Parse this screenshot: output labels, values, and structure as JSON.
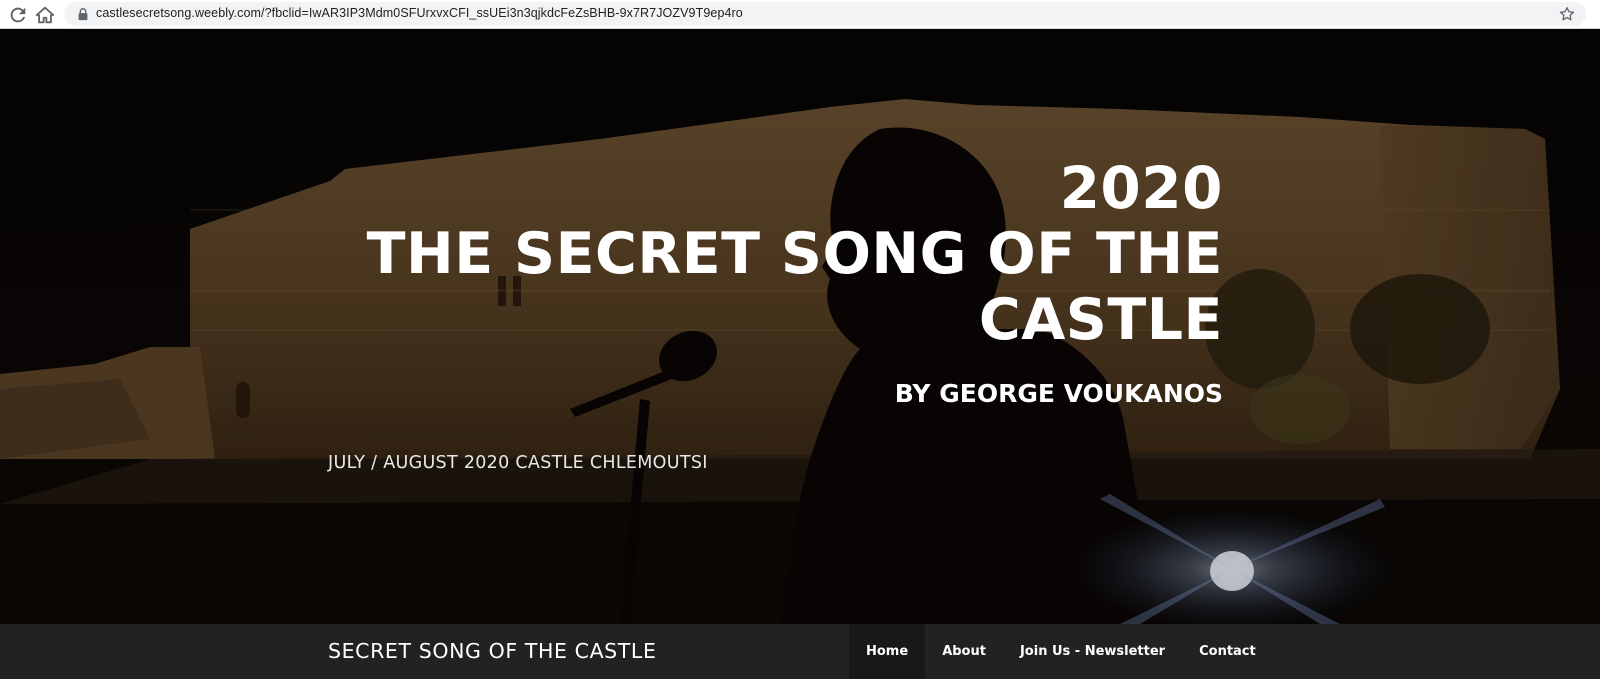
{
  "browser": {
    "url": "castlesecretsong.weebly.com/?fbclid=IwAR3IP3Mdm0SFUrxvxCFI_ssUEi3n3qjkdcFeZsBHB-9x7R7JOZV9T9ep4ro",
    "icons": [
      "reload-icon",
      "home-icon",
      "lock-icon",
      "star-icon"
    ]
  },
  "hero": {
    "year": "2020",
    "title": "THE SECRET SONG OF THE CASTLE",
    "byline": "BY GEORGE VOUKANOS",
    "subtitle": "JULY / AUGUST 2020 CASTLE CHLEMOUTSI"
  },
  "nav": {
    "site_title": "SECRET SONG OF THE CASTLE",
    "items": [
      {
        "label": "Home",
        "active": true
      },
      {
        "label": "About",
        "active": false
      },
      {
        "label": "Join Us - Newsletter",
        "active": false
      },
      {
        "label": "Contact",
        "active": false
      }
    ]
  },
  "colors": {
    "nav_background": "#222222",
    "nav_active": "#181818",
    "hero_text": "#ffffff"
  }
}
